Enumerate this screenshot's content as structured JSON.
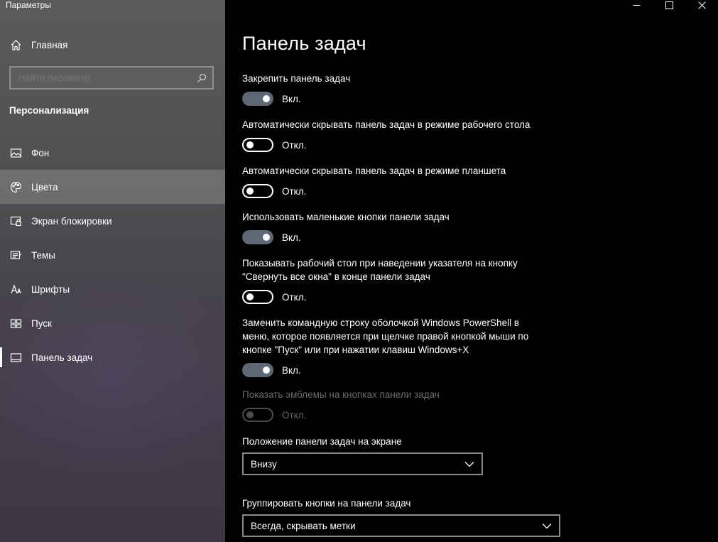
{
  "window": {
    "title": "Параметры"
  },
  "sidebar": {
    "home_label": "Главная",
    "search_placeholder": "Найти параметр",
    "section_title": "Персонализация",
    "items": [
      {
        "label": "Фон",
        "icon": "image-icon"
      },
      {
        "label": "Цвета",
        "icon": "palette-icon"
      },
      {
        "label": "Экран блокировки",
        "icon": "lock-screen-icon"
      },
      {
        "label": "Темы",
        "icon": "brush-icon"
      },
      {
        "label": "Шрифты",
        "icon": "font-icon"
      },
      {
        "label": "Пуск",
        "icon": "start-icon"
      },
      {
        "label": "Панель задач",
        "icon": "taskbar-icon"
      }
    ]
  },
  "main": {
    "title": "Панель задач",
    "settings": [
      {
        "label": "Закрепить панель задач",
        "state": "Вкл."
      },
      {
        "label": "Автоматически скрывать панель задач в режиме рабочего стола",
        "state": "Откл."
      },
      {
        "label": "Автоматически скрывать панель задач в режиме планшета",
        "state": "Откл."
      },
      {
        "label": "Использовать маленькие кнопки панели задач",
        "state": "Вкл."
      },
      {
        "label_line1": "Показывать рабочий стол при наведении указателя на кнопку",
        "label_line2": "\"Свернуть все окна\" в конце панели задач",
        "state": "Откл."
      },
      {
        "label_line1": "Заменить командную строку оболочкой Windows PowerShell в",
        "label_line2": "меню, которое появляется при щелчке правой кнопкой мыши по",
        "label_line3": "кнопке \"Пуск\" или при нажатии клавиш Windows+X",
        "state": "Вкл."
      },
      {
        "label": "Показать эмблемы на кнопках панели задач",
        "state": "Откл."
      }
    ],
    "position": {
      "label": "Положение панели задач на экране",
      "value": "Внизу"
    },
    "grouping": {
      "label": "Группировать кнопки на панели задач",
      "value": "Всегда, скрывать метки"
    }
  },
  "colors": {
    "toggle_on": "#5d6775",
    "sidebar_bg": "#525252",
    "content_bg": "#000000"
  }
}
